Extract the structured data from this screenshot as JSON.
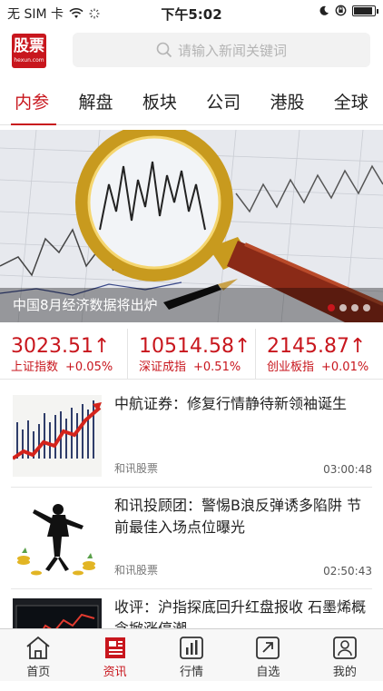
{
  "status_bar": {
    "carrier": "无 SIM 卡",
    "time": "下午5:02",
    "colors": {
      "text": "#222222"
    }
  },
  "header": {
    "logo_text": "股票",
    "logo_subtext": "hexun.com",
    "search_placeholder": "请输入新闻关键词"
  },
  "tabs": [
    {
      "label": "内参",
      "active": true
    },
    {
      "label": "解盘",
      "active": false
    },
    {
      "label": "板块",
      "active": false
    },
    {
      "label": "公司",
      "active": false
    },
    {
      "label": "港股",
      "active": false
    },
    {
      "label": "全球",
      "active": false
    }
  ],
  "banner": {
    "caption": "中国8月经济数据将出炉",
    "dot_count": 4,
    "active_dot": 0
  },
  "indices": [
    {
      "value": "3023.51",
      "arrow": "↑",
      "name": "上证指数",
      "change": "+0.05%"
    },
    {
      "value": "10514.58",
      "arrow": "↑",
      "name": "深证成指",
      "change": "+0.51%"
    },
    {
      "value": "2145.87",
      "arrow": "↑",
      "name": "创业板指",
      "change": "+0.01%"
    }
  ],
  "news": [
    {
      "title": "中航证券：修复行情静待新领袖诞生",
      "source": "和讯股票",
      "time": "03:00:48",
      "thumb": "rising-chart"
    },
    {
      "title": "和讯投顾团：警惕B浪反弹诱多陷阱 节前最佳入场点位曝光",
      "source": "和讯股票",
      "time": "02:50:43",
      "thumb": "dancing-man-coins"
    },
    {
      "title": "收评：沪指探底回升红盘报收 石墨烯概念掀涨停潮",
      "source": "",
      "time": "",
      "thumb": "trading-screen"
    }
  ],
  "tabbar": [
    {
      "label": "首页",
      "icon": "home-icon",
      "active": false
    },
    {
      "label": "资讯",
      "icon": "news-icon",
      "active": true
    },
    {
      "label": "行情",
      "icon": "market-icon",
      "active": false
    },
    {
      "label": "自选",
      "icon": "watchlist-icon",
      "active": false
    },
    {
      "label": "我的",
      "icon": "profile-icon",
      "active": false
    }
  ],
  "colors": {
    "accent": "#c8161d",
    "muted": "#777777"
  }
}
